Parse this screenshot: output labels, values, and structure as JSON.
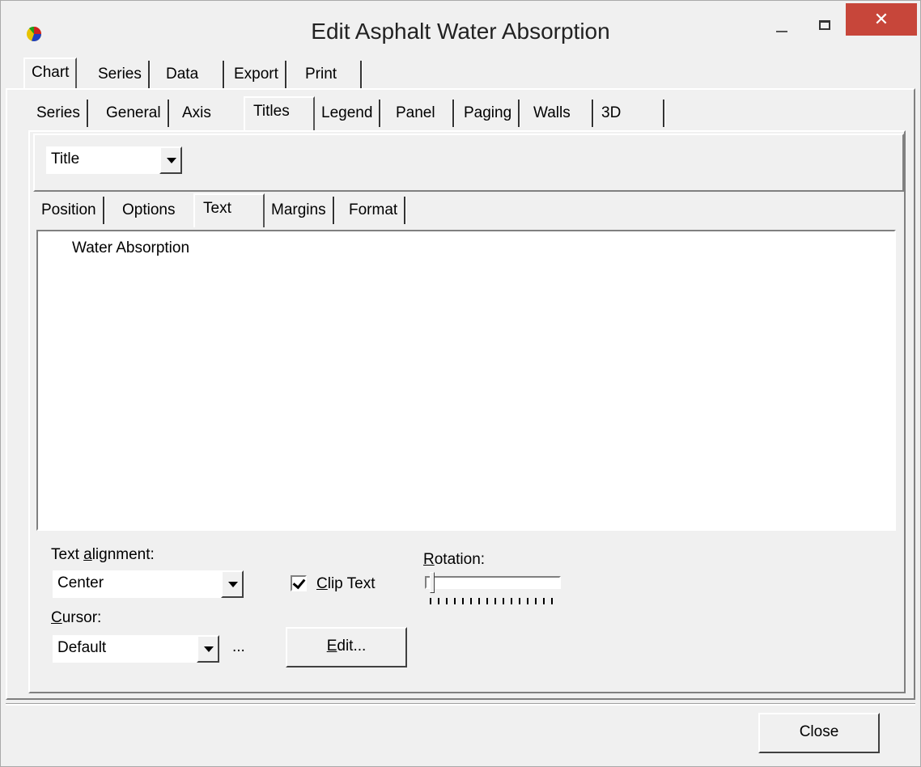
{
  "window": {
    "title": "Edit Asphalt Water Absorption",
    "close_glyph": "✕"
  },
  "top_tabs": [
    "Chart",
    "Series",
    "Data",
    "Export",
    "Print"
  ],
  "chart_tabs": [
    "Series",
    "General",
    "Axis",
    "Titles",
    "Legend",
    "Panel",
    "Paging",
    "Walls",
    "3D"
  ],
  "title_selector": {
    "value": "Title"
  },
  "titles_tabs": [
    "Position",
    "Options",
    "Text",
    "Margins",
    "Format"
  ],
  "text_memo": {
    "value": "Water Absorption"
  },
  "text_alignment": {
    "label_pre": "Text ",
    "label_underlined": "a",
    "label_post": "lignment:",
    "value": "Center"
  },
  "clip_text": {
    "label_pre": "",
    "label_underlined": "C",
    "label_post": "lip Text",
    "checked": true
  },
  "rotation": {
    "label_pre": "",
    "label_underlined": "R",
    "label_post": "otation:",
    "value": 0
  },
  "cursor": {
    "label_pre": "",
    "label_underlined": "C",
    "label_post": "ursor:",
    "value": "Default",
    "ellipsis": "..."
  },
  "edit_button": {
    "label_underlined": "E",
    "label_post": "dit..."
  },
  "close_button": {
    "label": "Close"
  },
  "icons": {
    "app": "teechart-icon",
    "minimize": "minimize-icon",
    "maximize": "maximize-icon",
    "close": "close-icon"
  }
}
